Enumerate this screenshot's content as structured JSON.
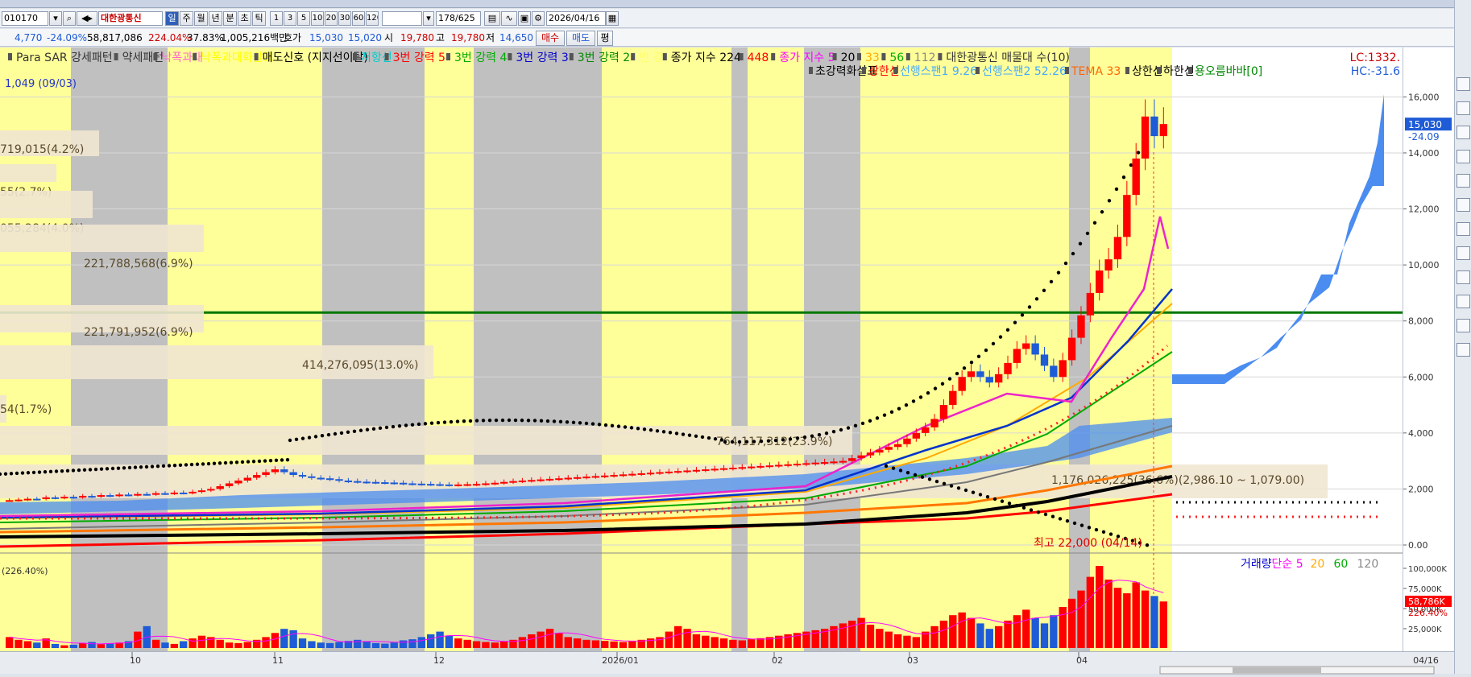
{
  "toolbar": {
    "code": "010170",
    "stock_name": "대한광통신",
    "period_buttons": [
      "일",
      "주",
      "월",
      "년",
      "분",
      "초",
      "틱"
    ],
    "minute_buttons": [
      "1",
      "3",
      "5",
      "10",
      "20",
      "30",
      "60",
      "120"
    ],
    "count": "178/625",
    "date": "2026/04/16"
  },
  "quote": {
    "price": "4,770",
    "change_pct": "-24.09%",
    "volume": "58,817,086",
    "vol_ratio": "224.04%",
    "turnover": "37.83%",
    "amount": "1,005,216백만",
    "hoga_label": "호가",
    "ask": "15,030",
    "bid": "15,020",
    "high_label": "시",
    "open": "19,780",
    "high_label2": "고",
    "high": "19,780",
    "low_label": "저",
    "low": "14,650",
    "buy_btn": "매수",
    "sell_btn": "매도",
    "eval_btn": "평"
  },
  "legend_row1": [
    {
      "text": "Para SAR 강세패턴",
      "color": "#333333"
    },
    {
      "text": "약세패턴",
      "color": "#333333"
    },
    {
      "text": "낙폭과대",
      "color": "#ff66cc"
    },
    {
      "text": "낙폭과대화살표",
      "color": "#ffff00"
    },
    {
      "text": "매도신호 (지지선이탈)",
      "color": "#000000"
    },
    {
      "text": "저항선",
      "color": "#00cccc"
    },
    {
      "text": "3번 강력 5",
      "color": "#ff0000"
    },
    {
      "text": "3번 강력 4",
      "color": "#00aa00"
    },
    {
      "text": "3번 강력 3",
      "color": "#0000cc"
    },
    {
      "text": "3번 강력 2",
      "color": "#008800"
    },
    {
      "text": "번 강",
      "color": "#ffff66"
    },
    {
      "text": "종가 지수 224",
      "color": "#000000"
    },
    {
      "text": "448",
      "color": "#ff0000"
    },
    {
      "text": "종가 지수 5",
      "color": "#ff00ff"
    },
    {
      "text": "20",
      "color": "#000000"
    },
    {
      "text": "33",
      "color": "#ffaa00"
    },
    {
      "text": "56",
      "color": "#00aa00"
    },
    {
      "text": "112",
      "color": "#888888"
    },
    {
      "text": "대한광통신 매물대 수(10)",
      "color": "#333333"
    }
  ],
  "legend_row2": [
    {
      "text": "초강력화살표",
      "color": "#000000"
    },
    {
      "text": "상한선",
      "color": "#ff0000"
    },
    {
      "text": "선행스팬1 9.26",
      "color": "#44aaff"
    },
    {
      "text": "선행스팬2 52.26",
      "color": "#44aaff"
    },
    {
      "text": "TEMA 33",
      "color": "#ff6600"
    },
    {
      "text": "상한선",
      "color": "#000000"
    },
    {
      "text": "하한선",
      "color": "#000000"
    },
    {
      "text": "용오름바바[0]",
      "color": "#008800"
    }
  ],
  "lc_label": "LC:1332.",
  "hc_label": "HC:-31.6",
  "low_marker": "1,049 (09/03)",
  "high_marker": "최고 22,000 (04/14)",
  "volume_profile": [
    "719,015(4.2%)",
    "55(2.7%)",
    "055,284(4.0%)",
    "221,788,568(6.9%)",
    "221,791,952(6.9%)",
    "414,276,095(13.0%)",
    "54(1.7%)",
    "764,117,312(23.9%)",
    "1,176,026,225(36.6%)(2,986.10 ~ 1,079.00)"
  ],
  "price_axis_labels": [
    "16,000",
    "14,000",
    "12,000",
    "10,000",
    "8,000",
    "6,000",
    "4,000",
    "2,000",
    "0.00"
  ],
  "current_price_tag": "15,030",
  "current_change_tag": "-24.09",
  "volume_panel": {
    "ratio_label": "(226.40%)",
    "legend": [
      {
        "text": "거래량",
        "color": "#0000cc"
      },
      {
        "text": "단순 5",
        "color": "#ff00ff"
      },
      {
        "text": "20",
        "color": "#ffaa00"
      },
      {
        "text": "60",
        "color": "#00aa00"
      },
      {
        "text": "120",
        "color": "#888888"
      }
    ],
    "axis_labels": [
      "100,000K",
      "75,000K",
      "50,000K",
      "25,000K"
    ],
    "volume_tag": "58,786K",
    "ratio_tag": "226.40%"
  },
  "x_axis_labels": [
    "10",
    "11",
    "12",
    "2026/01",
    "02",
    "03",
    "04"
  ],
  "x_axis_end": "04/16",
  "colors": {
    "up": "#ff0000",
    "down": "#1e5bd6",
    "highlight_yellow": "#ffff99",
    "highlight_gray": "#c0c0c0",
    "ichimoku_cloud": "#4a8cf0",
    "support_line": "#007700"
  },
  "chart_data": {
    "type": "candlestick",
    "ylim": [
      0,
      16500
    ],
    "y_ticks": [
      0,
      2000,
      4000,
      6000,
      8000,
      10000,
      12000,
      14000,
      16000
    ],
    "horizontal_line": 8300,
    "close_series": [
      1600,
      1620,
      1650,
      1640,
      1700,
      1680,
      1720,
      1700,
      1750,
      1730,
      1780,
      1760,
      1800,
      1790,
      1820,
      1810,
      1850,
      1840,
      1870,
      1860,
      1900,
      1950,
      2000,
      2100,
      2200,
      2300,
      2400,
      2500,
      2600,
      2700,
      2600,
      2500,
      2450,
      2400,
      2380,
      2350,
      2300,
      2280,
      2260,
      2250,
      2240,
      2230,
      2220,
      2200,
      2190,
      2180,
      2170,
      2160,
      2150,
      2160,
      2170,
      2180,
      2200,
      2220,
      2250,
      2280,
      2300,
      2320,
      2340,
      2360,
      2380,
      2400,
      2420,
      2440,
      2460,
      2480,
      2500,
      2520,
      2540,
      2560,
      2580,
      2600,
      2620,
      2640,
      2660,
      2680,
      2700,
      2720,
      2740,
      2760,
      2780,
      2800,
      2820,
      2840,
      2860,
      2880,
      2900,
      2920,
      2940,
      2960,
      2980,
      3000,
      3100,
      3200,
      3300,
      3400,
      3500,
      3600,
      3800,
      4000,
      4200,
      4500,
      5000,
      5500,
      6000,
      6200,
      6000,
      5800,
      6100,
      6500,
      7000,
      7200,
      6800,
      6400,
      6000,
      6600,
      7400,
      8200,
      9000,
      9800,
      10200,
      11000,
      12500,
      13800,
      15300,
      14600,
      15030
    ],
    "volume_series": [
      40,
      30,
      25,
      20,
      35,
      15,
      10,
      12,
      18,
      22,
      14,
      16,
      20,
      25,
      60,
      80,
      30,
      20,
      15,
      25,
      35,
      45,
      40,
      30,
      20,
      18,
      22,
      30,
      40,
      55,
      70,
      65,
      35,
      25,
      20,
      18,
      22,
      26,
      30,
      24,
      18,
      16,
      20,
      28,
      32,
      40,
      50,
      60,
      45,
      35,
      30,
      25,
      22,
      20,
      24,
      30,
      40,
      50,
      60,
      70,
      55,
      40,
      35,
      30,
      28,
      26,
      24,
      22,
      26,
      30,
      35,
      40,
      60,
      80,
      70,
      50,
      45,
      40,
      35,
      30,
      28,
      32,
      36,
      40,
      45,
      50,
      55,
      60,
      65,
      70,
      80,
      90,
      100,
      110,
      85,
      70,
      60,
      50,
      45,
      40,
      60,
      80,
      100,
      120,
      130,
      110,
      90,
      70,
      80,
      100,
      120,
      140,
      110,
      90,
      120,
      150,
      180,
      210,
      260,
      300,
      250,
      220,
      200,
      240,
      210,
      190,
      170
    ]
  }
}
